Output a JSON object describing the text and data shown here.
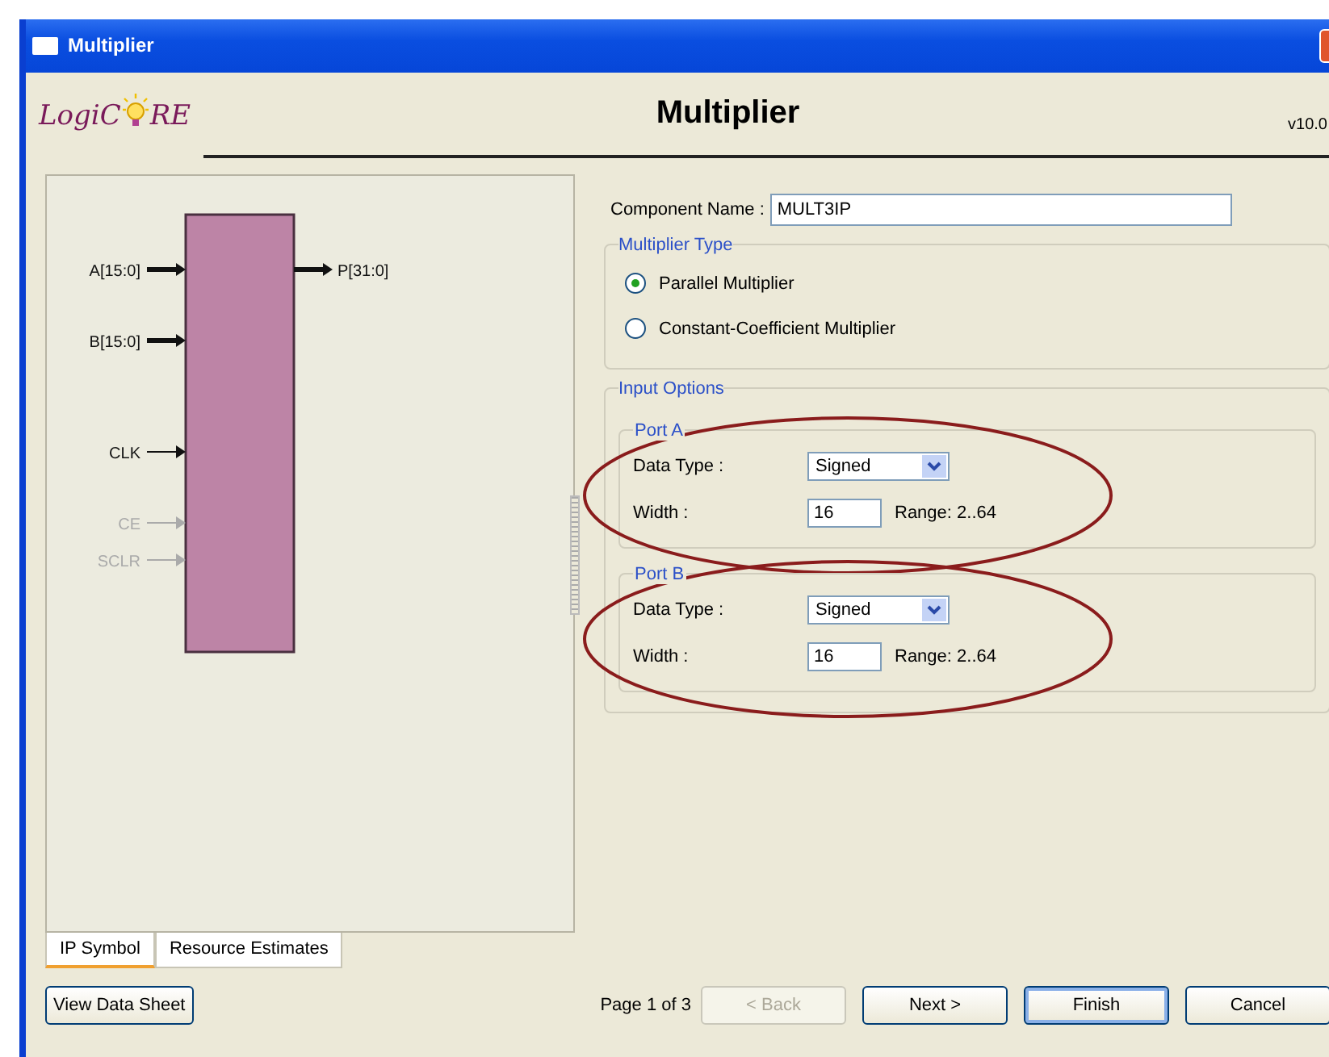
{
  "window": {
    "title": "Multiplier"
  },
  "header": {
    "logo_left": "LogiC",
    "logo_right": "RE",
    "title": "Multiplier",
    "version": "v10.0"
  },
  "symbol": {
    "inputs": [
      {
        "label": "A[15:0]",
        "bus": true,
        "enabled": true
      },
      {
        "label": "B[15:0]",
        "bus": true,
        "enabled": true
      },
      {
        "label": "CLK",
        "bus": false,
        "enabled": true
      },
      {
        "label": "CE",
        "bus": false,
        "enabled": false
      },
      {
        "label": "SCLR",
        "bus": false,
        "enabled": false
      }
    ],
    "outputs": [
      {
        "label": "P[31:0]",
        "bus": true,
        "enabled": true
      }
    ]
  },
  "left_tabs": [
    {
      "label": "IP Symbol",
      "selected": true
    },
    {
      "label": "Resource Estimates",
      "selected": false
    }
  ],
  "component_name": {
    "label": "Component Name :",
    "value": "MULT3IP"
  },
  "multiplier_type": {
    "title": "Multiplier Type",
    "options": [
      {
        "label": "Parallel Multiplier",
        "selected": true
      },
      {
        "label": "Constant-Coefficient Multiplier",
        "selected": false
      }
    ]
  },
  "input_options": {
    "title": "Input Options",
    "ports": [
      {
        "title": "Port A",
        "type_label": "Data Type :",
        "type_value": "Signed",
        "width_label": "Width :",
        "width_value": "16",
        "range": "Range: 2..64",
        "circled": true
      },
      {
        "title": "Port B",
        "type_label": "Data Type :",
        "type_value": "Signed",
        "width_label": "Width :",
        "width_value": "16",
        "range": "Range: 2..64",
        "circled": true
      }
    ]
  },
  "footer": {
    "datasheet_button": "View Data Sheet",
    "page": "Page 1 of 3",
    "buttons": [
      {
        "label": "< Back",
        "disabled": true,
        "default": false
      },
      {
        "label": "Next >",
        "disabled": false,
        "default": false
      },
      {
        "label": "Finish",
        "disabled": false,
        "default": true
      },
      {
        "label": "Cancel",
        "disabled": false,
        "default": false
      }
    ]
  }
}
